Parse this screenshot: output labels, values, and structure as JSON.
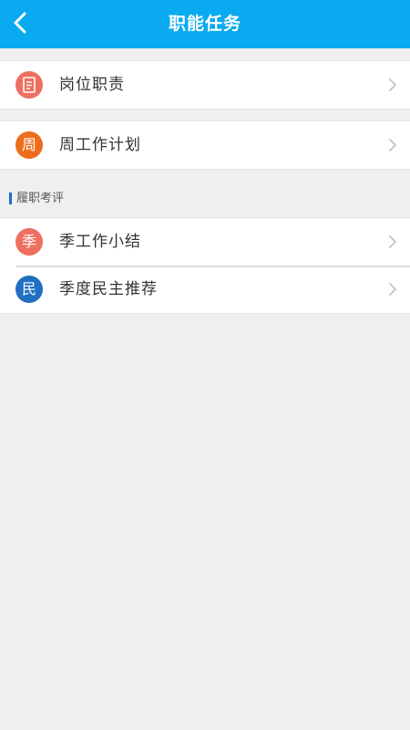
{
  "header": {
    "title": "职能任务",
    "background": "#0aaaf0"
  },
  "groups": [
    {
      "items": [
        {
          "label": "岗位职责",
          "icon": "document-icon",
          "icon_color": "#ee6f60"
        }
      ]
    },
    {
      "items": [
        {
          "label": "周工作计划",
          "icon_text": "周",
          "icon_color": "#ed6d1c"
        }
      ]
    }
  ],
  "section": {
    "title": "履职考评",
    "accent": "#1f6fc1",
    "items": [
      {
        "label": "季工作小结",
        "icon_text": "季",
        "icon_color": "#ee6f60"
      },
      {
        "label": "季度民主推荐",
        "icon_text": "民",
        "icon_color": "#1f6fc1"
      }
    ]
  }
}
